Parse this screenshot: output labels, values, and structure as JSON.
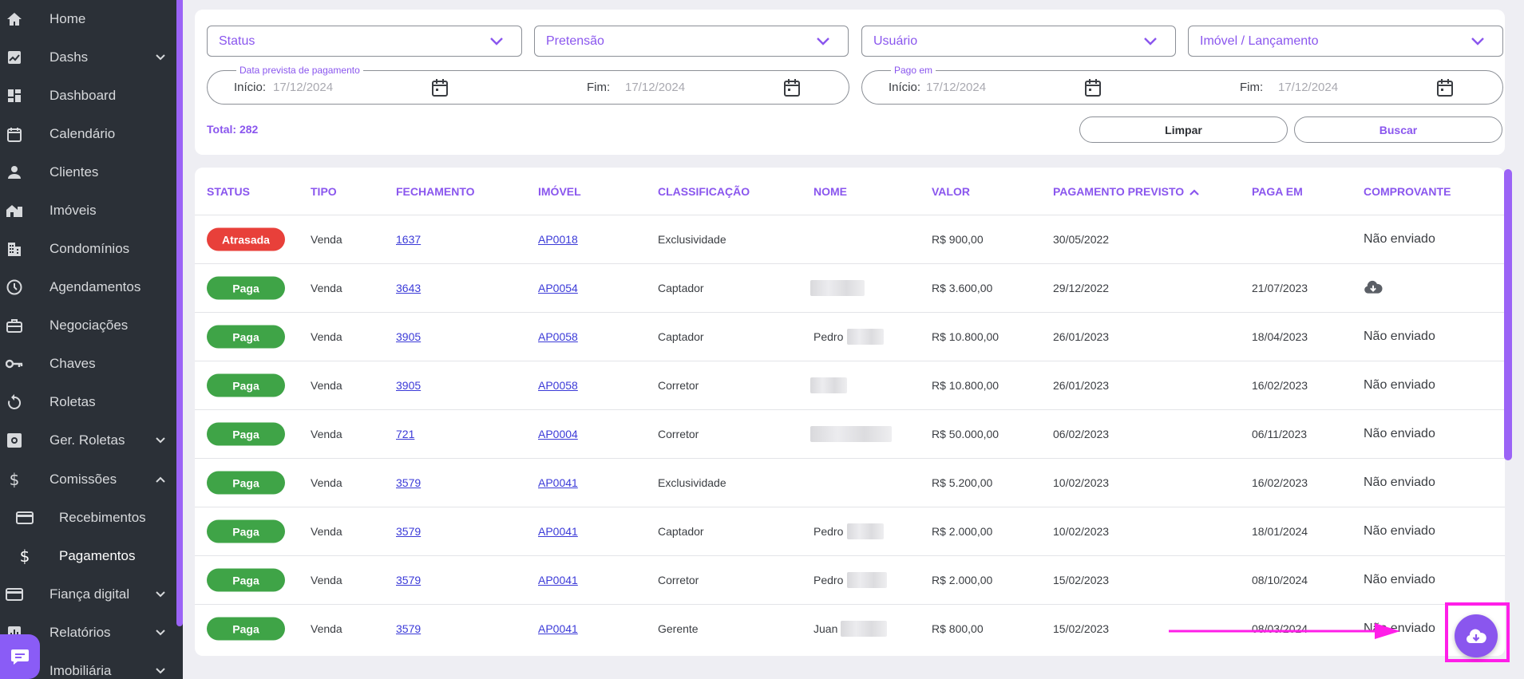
{
  "sidebar": {
    "items": [
      {
        "label": "Home",
        "icon": "home-icon",
        "chevron": false
      },
      {
        "label": "Dashs",
        "icon": "chart-icon",
        "chevron": true
      },
      {
        "label": "Dashboard",
        "icon": "dashboard-icon",
        "chevron": false
      },
      {
        "label": "Calendário",
        "icon": "calendar-icon",
        "chevron": false
      },
      {
        "label": "Clientes",
        "icon": "person-icon",
        "chevron": false
      },
      {
        "label": "Imóveis",
        "icon": "house-icon",
        "chevron": false
      },
      {
        "label": "Condomínios",
        "icon": "building-icon",
        "chevron": false
      },
      {
        "label": "Agendamentos",
        "icon": "clock-icon",
        "chevron": false
      },
      {
        "label": "Negociações",
        "icon": "briefcase-icon",
        "chevron": false
      },
      {
        "label": "Chaves",
        "icon": "key-icon",
        "chevron": false
      },
      {
        "label": "Roletas",
        "icon": "rotate-icon",
        "chevron": false
      },
      {
        "label": "Ger. Roletas",
        "icon": "gear-icon",
        "chevron": true
      },
      {
        "label": "Comissões",
        "icon": "dollar-icon",
        "chevron": true,
        "expanded": true
      },
      {
        "label": "Recebimentos",
        "icon": "card-icon",
        "chevron": false,
        "sub": true
      },
      {
        "label": "Pagamentos",
        "icon": "dollar-icon",
        "chevron": false,
        "sub": true,
        "active": true
      },
      {
        "label": "Fiança digital",
        "icon": "card-icon",
        "chevron": true
      },
      {
        "label": "Relatórios",
        "icon": "report-icon",
        "chevron": true
      },
      {
        "label": "Imobiliária",
        "icon": "building-icon",
        "chevron": true
      }
    ]
  },
  "filters": {
    "status": "Status",
    "pretensao": "Pretensão",
    "usuario": "Usuário",
    "imovel": "Imóvel / Lançamento",
    "data_prevista": {
      "legend": "Data prevista de pagamento",
      "inicio_label": "Início:",
      "inicio_value": "17/12/2024",
      "fim_label": "Fim:",
      "fim_value": "17/12/2024"
    },
    "pago_em": {
      "legend": "Pago em",
      "inicio_label": "Início:",
      "inicio_value": "17/12/2024",
      "fim_label": "Fim:",
      "fim_value": "17/12/2024"
    },
    "total": "Total: 282",
    "limpar": "Limpar",
    "buscar": "Buscar"
  },
  "table": {
    "headers": [
      "STATUS",
      "TIPO",
      "FECHAMENTO",
      "IMÓVEL",
      "CLASSIFICAÇÃO",
      "NOME",
      "VALOR",
      "PAGAMENTO PREVISTO",
      "PAGA EM",
      "COMPROVANTE"
    ],
    "rows": [
      {
        "status": "Atrasada",
        "late": true,
        "tipo": "Venda",
        "fechamento": "1637",
        "imovel": "AP0018",
        "classificacao": "Exclusividade",
        "nome": "",
        "valor": "R$ 900,00",
        "previsto": "30/05/2022",
        "paga_em": "",
        "comprovante": "Não enviado"
      },
      {
        "status": "Paga",
        "late": false,
        "tipo": "Venda",
        "fechamento": "3643",
        "imovel": "AP0054",
        "classificacao": "Captador",
        "nome": "",
        "valor": "R$ 3.600,00",
        "previsto": "29/12/2022",
        "paga_em": "21/07/2023",
        "comprovante": ""
      },
      {
        "status": "Paga",
        "late": false,
        "tipo": "Venda",
        "fechamento": "3905",
        "imovel": "AP0058",
        "classificacao": "Captador",
        "nome": "Pedro",
        "valor": "R$ 10.800,00",
        "previsto": "26/01/2023",
        "paga_em": "18/04/2023",
        "comprovante": "Não enviado"
      },
      {
        "status": "Paga",
        "late": false,
        "tipo": "Venda",
        "fechamento": "3905",
        "imovel": "AP0058",
        "classificacao": "Corretor",
        "nome": "",
        "valor": "R$ 10.800,00",
        "previsto": "26/01/2023",
        "paga_em": "16/02/2023",
        "comprovante": "Não enviado"
      },
      {
        "status": "Paga",
        "late": false,
        "tipo": "Venda",
        "fechamento": "721",
        "imovel": "AP0004",
        "classificacao": "Corretor",
        "nome": "",
        "valor": "R$ 50.000,00",
        "previsto": "06/02/2023",
        "paga_em": "06/11/2023",
        "comprovante": "Não enviado"
      },
      {
        "status": "Paga",
        "late": false,
        "tipo": "Venda",
        "fechamento": "3579",
        "imovel": "AP0041",
        "classificacao": "Exclusividade",
        "nome": "",
        "valor": "R$ 5.200,00",
        "previsto": "10/02/2023",
        "paga_em": "16/02/2023",
        "comprovante": "Não enviado"
      },
      {
        "status": "Paga",
        "late": false,
        "tipo": "Venda",
        "fechamento": "3579",
        "imovel": "AP0041",
        "classificacao": "Captador",
        "nome": "Pedro",
        "valor": "R$ 2.000,00",
        "previsto": "10/02/2023",
        "paga_em": "18/01/2024",
        "comprovante": "Não enviado"
      },
      {
        "status": "Paga",
        "late": false,
        "tipo": "Venda",
        "fechamento": "3579",
        "imovel": "AP0041",
        "classificacao": "Corretor",
        "nome": "Pedro",
        "valor": "R$ 2.000,00",
        "previsto": "15/02/2023",
        "paga_em": "08/10/2024",
        "comprovante": "Não enviado"
      },
      {
        "status": "Paga",
        "late": false,
        "tipo": "Venda",
        "fechamento": "3579",
        "imovel": "AP0041",
        "classificacao": "Gerente",
        "nome": "Juan",
        "valor": "R$ 800,00",
        "previsto": "15/02/2023",
        "paga_em": "08/03/2024",
        "comprovante": "Não enviado"
      }
    ]
  },
  "colors": {
    "accent": "#8a56ee",
    "late": "#e8403a",
    "paid": "#3fa447",
    "annotation": "#ff1ee8"
  }
}
